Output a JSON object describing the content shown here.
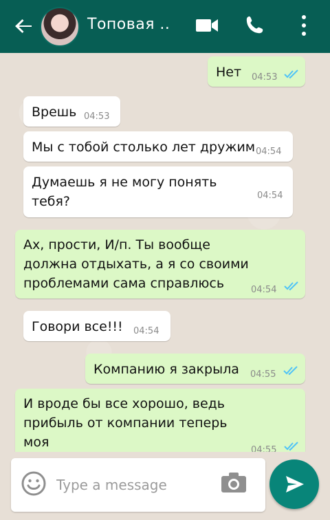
{
  "header": {
    "title": "Топовая ..",
    "icons": [
      "back-arrow-icon",
      "avatar",
      "video-call-icon",
      "phone-icon",
      "more-vertical-icon"
    ]
  },
  "messages": [
    {
      "side": "out",
      "text": "Нет",
      "time": "04:53",
      "status": "read"
    },
    {
      "side": "in",
      "text": "Врешь",
      "time": "04:53"
    },
    {
      "side": "in",
      "text": "Мы с тобой столько лет дружим",
      "time": "04:54"
    },
    {
      "side": "in",
      "text": "Думаешь я не могу понять тебя?",
      "time": "04:54"
    },
    {
      "side": "out",
      "text": "Ах, прости, И/п. Ты вообще должна отдыхать, а я со своими проблемами сама справлюсь",
      "time": "04:54",
      "status": "read"
    },
    {
      "side": "in",
      "text": "Говори все!!!",
      "time": "04:54"
    },
    {
      "side": "out",
      "text": "Компанию я закрыла",
      "time": "04:55",
      "status": "read"
    },
    {
      "side": "out",
      "text": "И вроде бы все хорошо, ведь прибыль от компании теперь моя",
      "time": "04:55",
      "status": "read"
    }
  ],
  "composer": {
    "placeholder": "Type a message"
  },
  "colors": {
    "header": "#075e54",
    "incoming": "#ffffff",
    "outgoing": "#dcf8c6",
    "send_button": "#088579",
    "tick": "#4fc3f7"
  }
}
